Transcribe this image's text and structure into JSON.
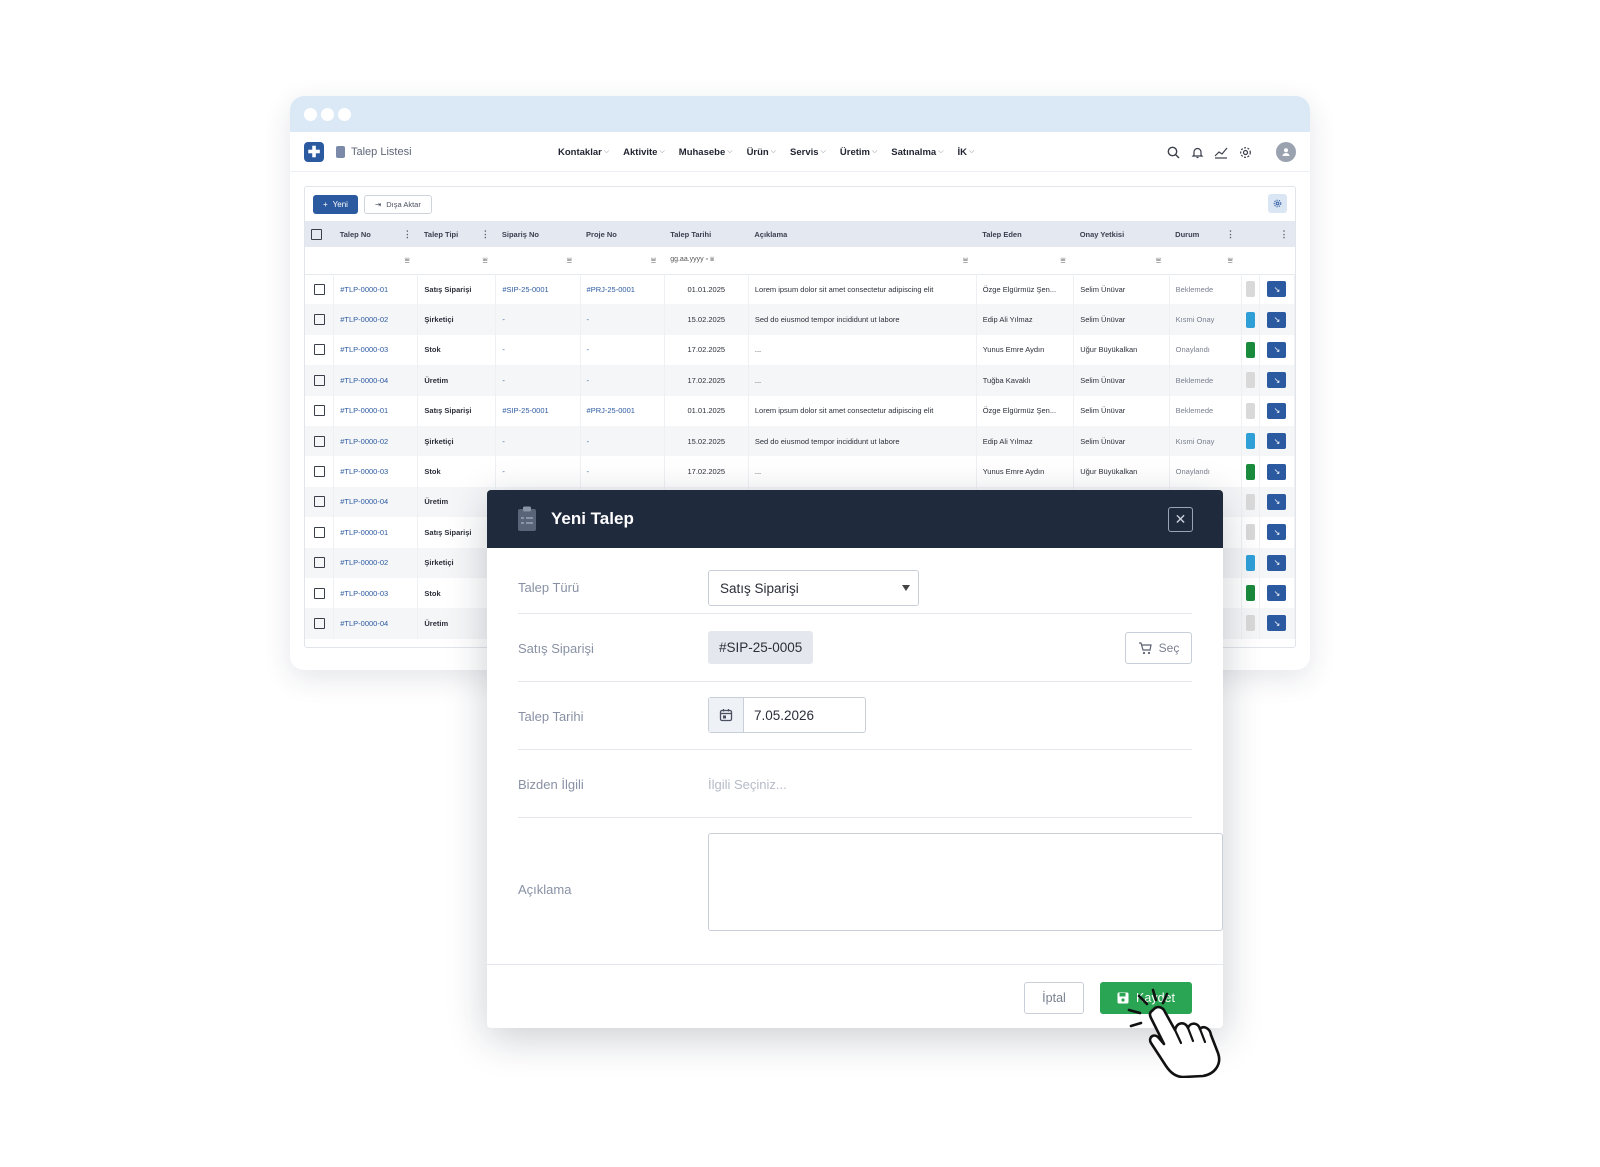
{
  "app": {
    "page_title": "Talep Listesi",
    "nav": [
      "Kontaklar",
      "Aktivite",
      "Muhasebe",
      "Ürün",
      "Servis",
      "Üretim",
      "Satınalma",
      "İK"
    ],
    "tools": [
      "search-icon",
      "bell-icon",
      "chart-icon",
      "gear-icon",
      "user-avatar"
    ]
  },
  "toolbar": {
    "new_label": "Yeni",
    "export_label": "Dışa Aktar"
  },
  "table": {
    "columns": [
      "Talep No",
      "Talep Tipi",
      "Sipariş No",
      "Proje No",
      "Talep Tarihi",
      "Açıklama",
      "Talep Eden",
      "Onay Yetkisi",
      "Durum"
    ],
    "date_filter_placeholder": "gg.aa.yyyy",
    "rows": [
      {
        "no": "#TLP-0000-01",
        "type": "Satış Siparişi",
        "order": "#SIP-25-0001",
        "project": "#PRJ-25-0001",
        "date": "01.01.2025",
        "desc": "Lorem ipsum dolor sit amet consectetur adipiscing elit",
        "by": "Özge Elgürmüz Şen...",
        "approver": "Selim Ünüvar",
        "status": "Beklemede",
        "color": "#d9d9d9"
      },
      {
        "no": "#TLP-0000-02",
        "type": "Şirketiçi",
        "order": "-",
        "project": "-",
        "date": "15.02.2025",
        "desc": "Sed do eiusmod tempor incididunt ut labore",
        "by": "Edip Ali Yılmaz",
        "approver": "Selim Ünüvar",
        "status": "Kısmi Onay",
        "color": "#2f9fd8"
      },
      {
        "no": "#TLP-0000-03",
        "type": "Stok",
        "order": "-",
        "project": "-",
        "date": "17.02.2025",
        "desc": "...",
        "by": "Yunus Emre Aydın",
        "approver": "Uğur Büyükalkan",
        "status": "Onaylandı",
        "color": "#1a8a3c"
      },
      {
        "no": "#TLP-0000-04",
        "type": "Üretim",
        "order": "-",
        "project": "-",
        "date": "17.02.2025",
        "desc": "...",
        "by": "Tuğba Kavaklı",
        "approver": "Selim Ünüvar",
        "status": "Beklemede",
        "color": "#d9d9d9"
      },
      {
        "no": "#TLP-0000-01",
        "type": "Satış Siparişi",
        "order": "#SIP-25-0001",
        "project": "#PRJ-25-0001",
        "date": "01.01.2025",
        "desc": "Lorem ipsum dolor sit amet consectetur adipiscing elit",
        "by": "Özge Elgürmüz Şen...",
        "approver": "Selim Ünüvar",
        "status": "Beklemede",
        "color": "#d9d9d9"
      },
      {
        "no": "#TLP-0000-02",
        "type": "Şirketiçi",
        "order": "-",
        "project": "-",
        "date": "15.02.2025",
        "desc": "Sed do eiusmod tempor incididunt ut labore",
        "by": "Edip Ali Yılmaz",
        "approver": "Selim Ünüvar",
        "status": "Kısmi Onay",
        "color": "#2f9fd8"
      },
      {
        "no": "#TLP-0000-03",
        "type": "Stok",
        "order": "-",
        "project": "-",
        "date": "17.02.2025",
        "desc": "...",
        "by": "Yunus Emre Aydın",
        "approver": "Uğur Büyükalkan",
        "status": "Onaylandı",
        "color": "#1a8a3c"
      },
      {
        "no": "#TLP-0000-04",
        "type": "Üretim",
        "order": "",
        "project": "",
        "date": "",
        "desc": "",
        "by": "",
        "approver": "",
        "status": "",
        "color": "#d9d9d9"
      },
      {
        "no": "#TLP-0000-01",
        "type": "Satış Siparişi",
        "order": "",
        "project": "",
        "date": "",
        "desc": "",
        "by": "",
        "approver": "",
        "status": "",
        "color": "#d9d9d9"
      },
      {
        "no": "#TLP-0000-02",
        "type": "Şirketiçi",
        "order": "",
        "project": "",
        "date": "",
        "desc": "",
        "by": "",
        "approver": "",
        "status": "",
        "color": "#2f9fd8"
      },
      {
        "no": "#TLP-0000-03",
        "type": "Stok",
        "order": "",
        "project": "",
        "date": "",
        "desc": "",
        "by": "",
        "approver": "",
        "status": "",
        "color": "#1a8a3c"
      },
      {
        "no": "#TLP-0000-04",
        "type": "Üretim",
        "order": "",
        "project": "",
        "date": "",
        "desc": "",
        "by": "",
        "approver": "",
        "status": "",
        "color": "#d9d9d9"
      }
    ]
  },
  "modal": {
    "title": "Yeni Talep",
    "fields": {
      "request_type_label": "Talep Türü",
      "request_type_value": "Satış Siparişi",
      "sales_order_label": "Satış Siparişi",
      "sales_order_value": "#SIP-25-0005",
      "select_button": "Seç",
      "request_date_label": "Talep Tarihi",
      "request_date_value": "7.05.2026",
      "related_label": "Bizden İlgili",
      "related_placeholder": "İlgili Seçiniz...",
      "description_label": "Açıklama"
    },
    "cancel_label": "İptal",
    "save_label": "Kaydet"
  }
}
